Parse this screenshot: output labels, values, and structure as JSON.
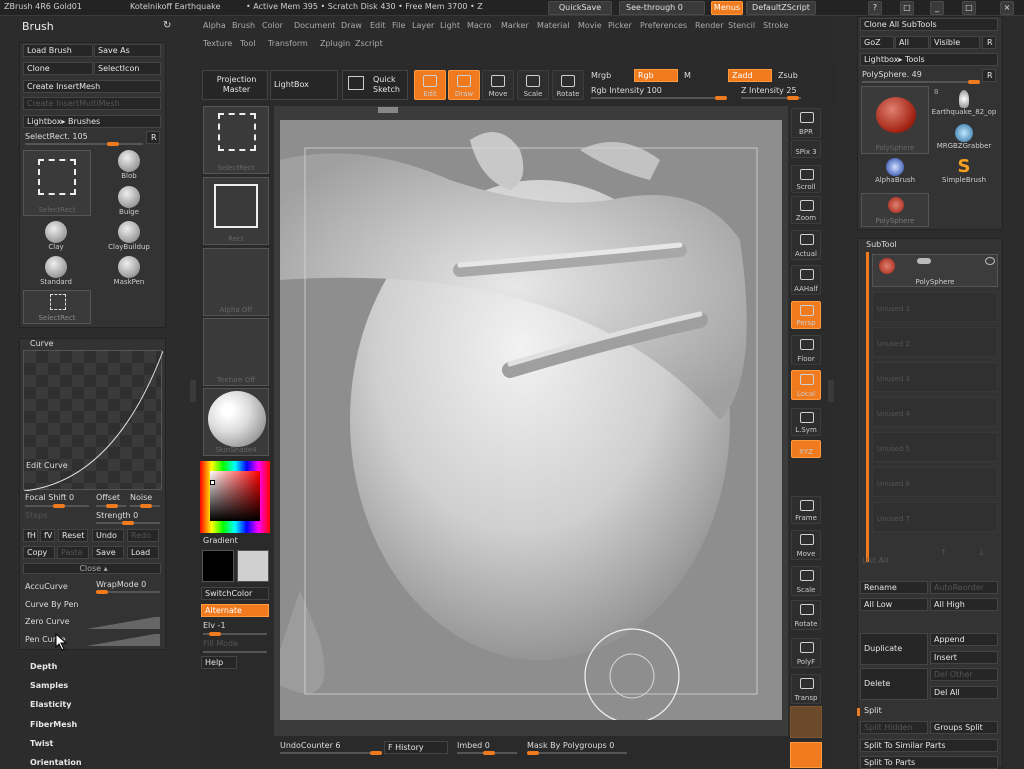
{
  "topbar": {
    "title": "ZBrush 4R6 Gold01",
    "doc": "Kotelnikoff Earthquake",
    "mem": "• Active Mem 395 • Scratch Disk 430 • Free Mem 3700 • Z",
    "quicksave": "QuickSave",
    "seethrough": "See-through 0",
    "menus": "Menus",
    "script": "DefaultZScript"
  },
  "menus": [
    "Alpha",
    "Brush",
    "Color",
    "Document",
    "Draw",
    "Edit",
    "File",
    "Layer",
    "Light",
    "Macro",
    "Marker",
    "Material",
    "Movie",
    "Picker",
    "Preferences",
    "Render",
    "Stencil",
    "Stroke"
  ],
  "menus2": [
    "Texture",
    "Tool",
    "Transform",
    "Zplugin",
    "Zscript"
  ],
  "brush": {
    "title": "Brush",
    "load": "Load Brush",
    "saveas": "Save As",
    "clone": "Clone",
    "selicon": "SelectIcon",
    "create_insert": "Create InsertMesh",
    "create_multi": "Create InsertMultiMesh",
    "lightbox": "Lightbox▸ Brushes",
    "selrect": "SelectRect. 105",
    "r": "R",
    "brushes": [
      "Blob",
      "Bulge",
      "Clay",
      "ClayBuildup",
      "Standard",
      "MaskPen"
    ],
    "current": "SelectRect",
    "sel2": "SelectRect"
  },
  "curve": {
    "title": "Curve",
    "edit": "Edit Curve",
    "focal": "Focal Shift 0",
    "offset": "Offset",
    "noise": "Noise",
    "steps": "Steps",
    "strength": "Strength 0",
    "btns": [
      "fH",
      "fV",
      "Reset",
      "Undo",
      "Redo"
    ],
    "copy": "Copy",
    "paste": "Paste",
    "save": "Save",
    "load": "Load",
    "close": "Close ▴",
    "accu": "AccuCurve",
    "wrap": "WrapMode 0",
    "bypen": "Curve By Pen",
    "zero": "Zero Curve",
    "pen": "Pen Curve"
  },
  "sections": [
    "Depth",
    "Samples",
    "Elasticity",
    "FiberMesh",
    "Twist",
    "Orientation"
  ],
  "toolbar": {
    "projection": "Projection Master",
    "lightbox": "LightBox",
    "quicksketch": "Quick Sketch",
    "edit": "Edit",
    "draw": "Draw",
    "move": "Move",
    "scale": "Scale",
    "rotate": "Rotate",
    "mrgb": "Mrgb",
    "rgb": "Rgb",
    "m": "M",
    "zadd": "Zadd",
    "zsub": "Zsub",
    "rgbint": "Rgb Intensity 100",
    "zint": "Z Intensity 25"
  },
  "leftshelf": {
    "selectrect": "SelectRect",
    "rect": "Rect",
    "alphaoff": "Alpha Off",
    "textureoff": "Texture Off",
    "mat": "SkinShade4",
    "gradient": "Gradient",
    "switchcolor": "SwitchColor",
    "alternate": "Alternate",
    "elv": "Elv -1",
    "fillmode": "Fill Mode",
    "help": "Help"
  },
  "rightshelf": [
    "BPR",
    "SPix 3",
    "Scroll",
    "Zoom",
    "Actual",
    "AAHalf",
    "Persp",
    "Floor",
    "Local",
    "L.Sym",
    "XYZ",
    "Frame",
    "Move",
    "Scale",
    "Rotate",
    "PolyF",
    "Transp"
  ],
  "bottom": {
    "undo": "UndoCounter 6",
    "history": "F History",
    "imbed": "Imbed 0",
    "mask": "Mask By Polygroups 0"
  },
  "tool": {
    "cloneall": "Clone All SubTools",
    "goz": "GoZ",
    "all": "All",
    "visible": "Visible",
    "r": "R",
    "lightbox": "Lightbox▸ Tools",
    "poly": "PolySphere. 49",
    "num": "8",
    "items": [
      "PolySphere",
      "Earthquake_82_op",
      "MRGBZGrabber",
      "AlphaBrush",
      "SimpleBrush",
      "PolySphere"
    ]
  },
  "subtool": {
    "title": "SubTool",
    "first": "PolySphere",
    "unused": [
      "Unused 1",
      "Unused 2",
      "Unused 3",
      "Unused 4",
      "Unused 5",
      "Unused 6",
      "Unused 7"
    ],
    "listall": "List All",
    "rename": "Rename",
    "autoreorder": "AutoReorder",
    "alllow": "All Low",
    "allhigh": "All High",
    "duplicate": "Duplicate",
    "append": "Append",
    "insert": "Insert",
    "delete": "Delete",
    "delother": "Del Other",
    "delall": "Del All",
    "split": "Split",
    "splithidden": "Split Hidden",
    "groupssplit": "Groups Split",
    "splitsimilar": "Split To Similar Parts",
    "splitparts": "Split To Parts"
  }
}
